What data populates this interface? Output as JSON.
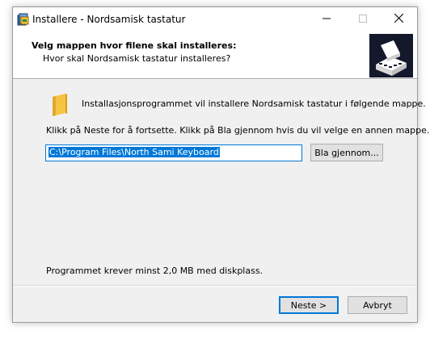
{
  "window": {
    "title": "Installere - Nordsamisk tastatur",
    "controls": {
      "minimize": "minimize",
      "maximize": "maximize",
      "close": "close"
    }
  },
  "header": {
    "title": "Velg mappen hvor filene skal installeres:",
    "subtitle": "Hvor skal Nordsamisk tastatur installeres?"
  },
  "body": {
    "intro": "Installasjonsprogrammet vil installere Nordsamisk tastatur i følgende mappe.",
    "instruction": "Klikk på Neste for å fortsette. Klikk på Bla gjennom hvis du vil velge en annen mappe.",
    "path_value": "C:\\Program Files\\North Sami Keyboard",
    "browse_label": "Bla gjennom...",
    "space_required": "Programmet krever minst 2,0 MB med diskplass."
  },
  "footer": {
    "next_label": "Neste >",
    "cancel_label": "Avbryt"
  },
  "colors": {
    "accent": "#0078d7",
    "header_image_bg": "#13182b",
    "dialog_bg": "#f0f0f0"
  },
  "icons": [
    "installer-app-icon",
    "minimize-icon",
    "maximize-icon",
    "close-icon",
    "keyboard-box-image",
    "folder-icon"
  ]
}
